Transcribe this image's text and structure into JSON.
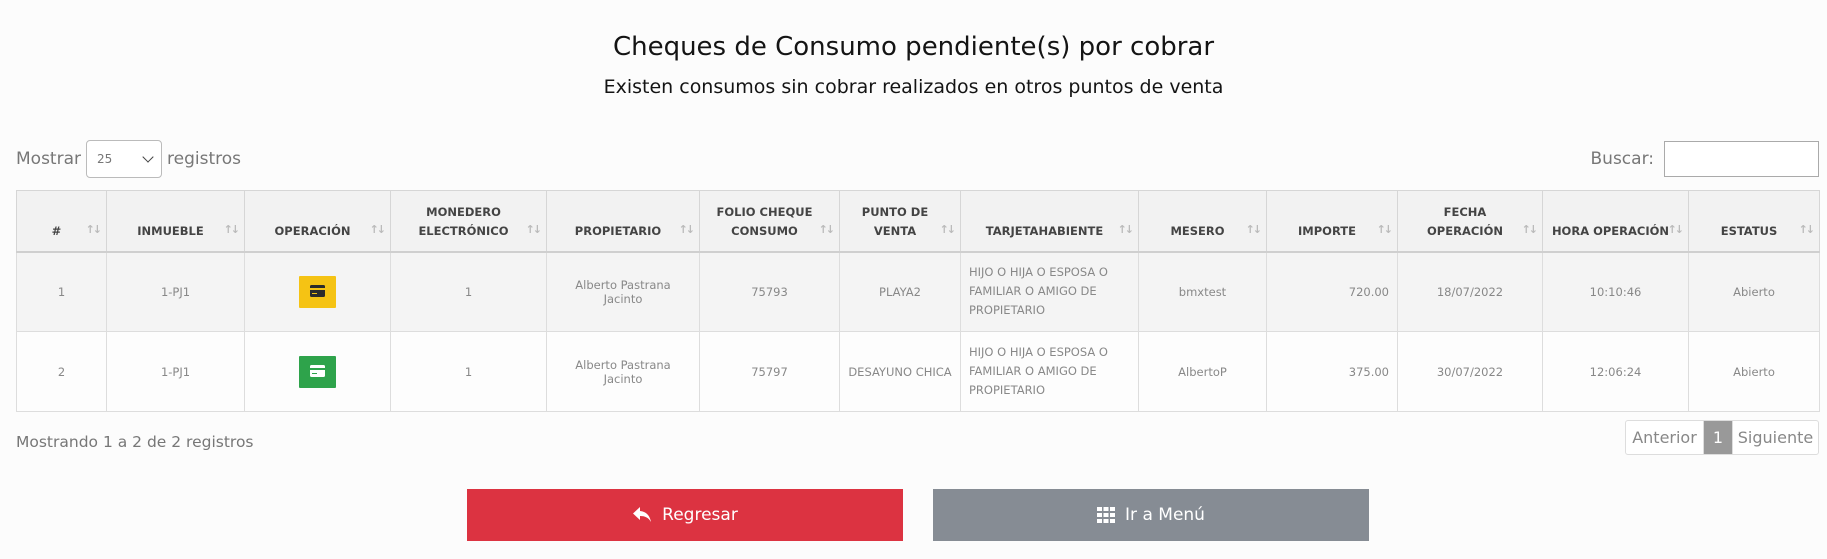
{
  "header": {
    "title": "Cheques de Consumo pendiente(s) por cobrar",
    "subtitle": "Existen consumos sin cobrar realizados en otros puntos de venta"
  },
  "length_control": {
    "prefix": "Mostrar",
    "value": "25",
    "suffix": "registros"
  },
  "search": {
    "label": "Buscar:",
    "value": ""
  },
  "table": {
    "columns": [
      "#",
      "INMUEBLE",
      "OPERACIÓN",
      "MONEDERO ELECTRÓNICO",
      "PROPIETARIO",
      "FOLIO CHEQUE CONSUMO",
      "PUNTO DE VENTA",
      "TARJETAHABIENTE",
      "MESERO",
      "IMPORTE",
      "FECHA OPERACIÓN",
      "HORA OPERACIÓN",
      "ESTATUS"
    ],
    "rows": [
      {
        "num": "1",
        "inmueble": "1-PJ1",
        "operacion_icon": "credit-card-icon",
        "operacion_color": "#f5c314",
        "monedero": "1",
        "propietario": "Alberto Pastrana Jacinto",
        "folio": "75793",
        "punto_venta": "PLAYA2",
        "tarjetahabiente": "HIJO O HIJA O ESPOSA O FAMILIAR O AMIGO DE PROPIETARIO",
        "mesero": "bmxtest",
        "importe": "720.00",
        "fecha": "18/07/2022",
        "hora": "10:10:46",
        "estatus": "Abierto"
      },
      {
        "num": "2",
        "inmueble": "1-PJ1",
        "operacion_icon": "credit-card-icon",
        "operacion_color": "#2ea34b",
        "monedero": "1",
        "propietario": "Alberto Pastrana Jacinto",
        "folio": "75797",
        "punto_venta": "DESAYUNO CHICA",
        "tarjetahabiente": "HIJO O HIJA O ESPOSA O FAMILIAR O AMIGO DE PROPIETARIO",
        "mesero": "AlbertoP",
        "importe": "375.00",
        "fecha": "30/07/2022",
        "hora": "12:06:24",
        "estatus": "Abierto"
      }
    ]
  },
  "info": "Mostrando 1 a 2 de 2 registros",
  "pagination": {
    "previous": "Anterior",
    "current": "1",
    "next": "Siguiente"
  },
  "buttons": {
    "back_label": "Regresar",
    "back_icon": "reply-icon",
    "back_color": "#dc3341",
    "menu_label": "Ir a Menú",
    "menu_icon": "grid-icon",
    "menu_color": "#868c94"
  }
}
